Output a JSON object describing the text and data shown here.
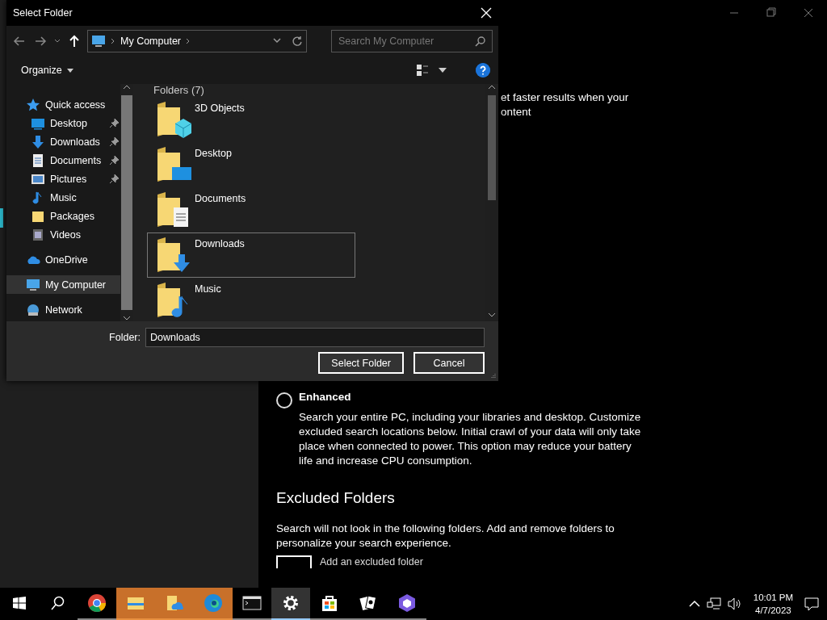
{
  "settings": {
    "partial_lines": [
      "et faster results when your",
      "ontent"
    ],
    "options": [
      {
        "label": "Enhanced",
        "description": "Search your entire PC, including your libraries and desktop. Customize excluded search locations below. Initial crawl of your data will only take place when connected to power. This option may reduce your battery life and increase CPU consumption.",
        "selected": false
      }
    ],
    "section_title": "Excluded Folders",
    "section_text": "Search will not look in the following folders. Add and remove folders to personalize your search experience.",
    "add_label": "Add an excluded folder"
  },
  "dialog": {
    "title": "Select Folder",
    "address": "My Computer",
    "search": {
      "placeholder": "Search My Computer"
    },
    "organize": "Organize",
    "nav": [
      {
        "label": "Quick access",
        "kind": "star",
        "selected": false,
        "children": [
          {
            "label": "Desktop",
            "kind": "desktop",
            "pinned": true,
            "selected": false
          },
          {
            "label": "Downloads",
            "kind": "download",
            "pinned": true,
            "selected": false
          },
          {
            "label": "Documents",
            "kind": "document",
            "pinned": true,
            "selected": false
          },
          {
            "label": "Pictures",
            "kind": "picture",
            "pinned": true,
            "selected": false
          },
          {
            "label": "Music",
            "kind": "music",
            "pinned": false,
            "selected": false
          },
          {
            "label": "Packages",
            "kind": "folder",
            "pinned": false,
            "selected": false
          },
          {
            "label": "Videos",
            "kind": "video",
            "pinned": false,
            "selected": false
          }
        ]
      },
      {
        "label": "OneDrive",
        "kind": "cloud",
        "selected": false
      },
      {
        "label": "My Computer",
        "kind": "computer",
        "selected": true
      },
      {
        "label": "Network",
        "kind": "network",
        "selected": false
      }
    ],
    "group_header": "Folders (7)",
    "items": [
      {
        "label": "3D Objects",
        "kind": "objects",
        "selected": false
      },
      {
        "label": "Desktop",
        "kind": "desktop",
        "selected": false
      },
      {
        "label": "Documents",
        "kind": "document",
        "selected": false
      },
      {
        "label": "Downloads",
        "kind": "download",
        "selected": true
      },
      {
        "label": "Music",
        "kind": "music",
        "selected": false
      }
    ],
    "folder_label": "Folder:",
    "folder_value": "Downloads",
    "buttons": [
      "Select Folder",
      "Cancel"
    ]
  },
  "taskbar": {
    "apps": [
      {
        "kind": "chrome",
        "flashing": false,
        "selected": false
      },
      {
        "kind": "explorer",
        "flashing": true,
        "selected": false
      },
      {
        "kind": "cloud-folder",
        "flashing": true,
        "selected": false
      },
      {
        "kind": "edge",
        "flashing": true,
        "selected": false
      },
      {
        "kind": "terminal",
        "flashing": false,
        "selected": false
      },
      {
        "kind": "settings",
        "flashing": false,
        "selected": true
      },
      {
        "kind": "store",
        "flashing": false,
        "selected": false
      },
      {
        "kind": "cards",
        "flashing": false,
        "selected": false
      },
      {
        "kind": "hexagon",
        "flashing": false,
        "selected": false
      }
    ],
    "time": "10:01 PM",
    "date": "4/7/2023"
  }
}
